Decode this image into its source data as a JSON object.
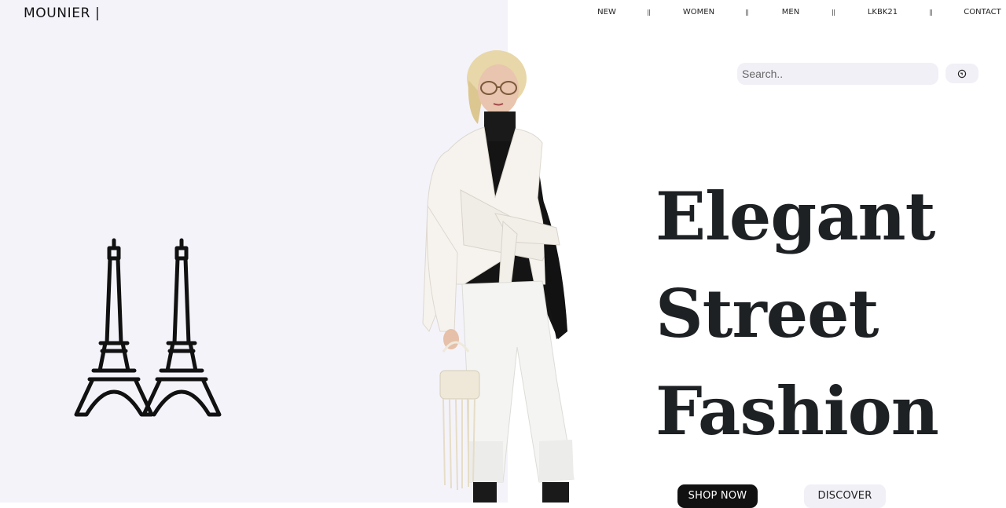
{
  "header": {
    "brand": "MOUNIER |",
    "nav": [
      "NEW",
      "WOMEN",
      "MEN",
      "LKBK21",
      "CONTACT"
    ]
  },
  "search": {
    "placeholder": "Search..",
    "value": "",
    "button_icon": "search-icon"
  },
  "hero": {
    "line1": "Elegant",
    "line2": "Street",
    "line3": "Fashion",
    "shop_label": "SHOP NOW",
    "discover_label": "DISCOVER"
  },
  "decor": {
    "logo_icon": "eiffel-towers-icon",
    "image": "fashion-model"
  },
  "colors": {
    "left_background": "#f4f3fa",
    "right_background": "#ffffff",
    "headline": "#1e2124",
    "primary_button": "#111111",
    "secondary_button": "#f1f0f7"
  }
}
